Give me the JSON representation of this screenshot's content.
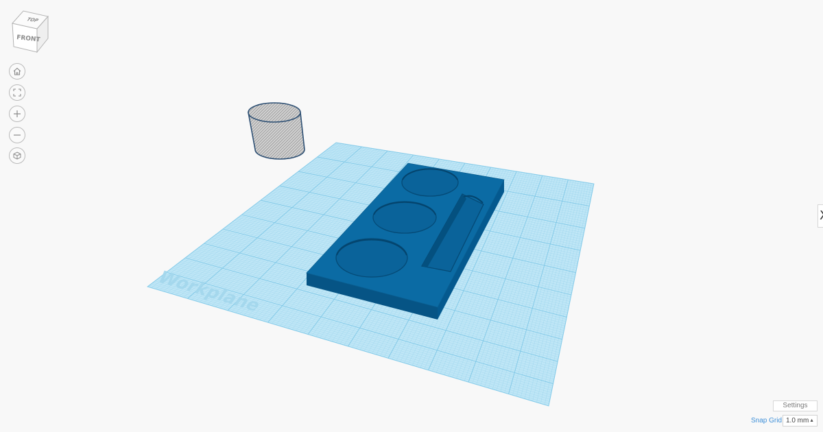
{
  "view_cube": {
    "top_label": "TOP",
    "front_label": "FRONT"
  },
  "navigation": {
    "home_icon": "home-icon",
    "fit_icon": "fit-all-icon",
    "zoom_in_icon": "plus-icon",
    "zoom_out_icon": "minus-icon",
    "perspective_icon": "cube-perspective-icon"
  },
  "workplane": {
    "watermark": "Workplane",
    "color": "#aee0f4",
    "grid_line_color": "#7cc6e6"
  },
  "model": {
    "color": "#0a6aa3",
    "hole_shape_color": "#9c9c9c"
  },
  "panel_toggle": {
    "label": "X"
  },
  "settings": {
    "label": "Settings"
  },
  "snap_grid": {
    "label": "Snap Grid",
    "value": "1.0 mm"
  }
}
